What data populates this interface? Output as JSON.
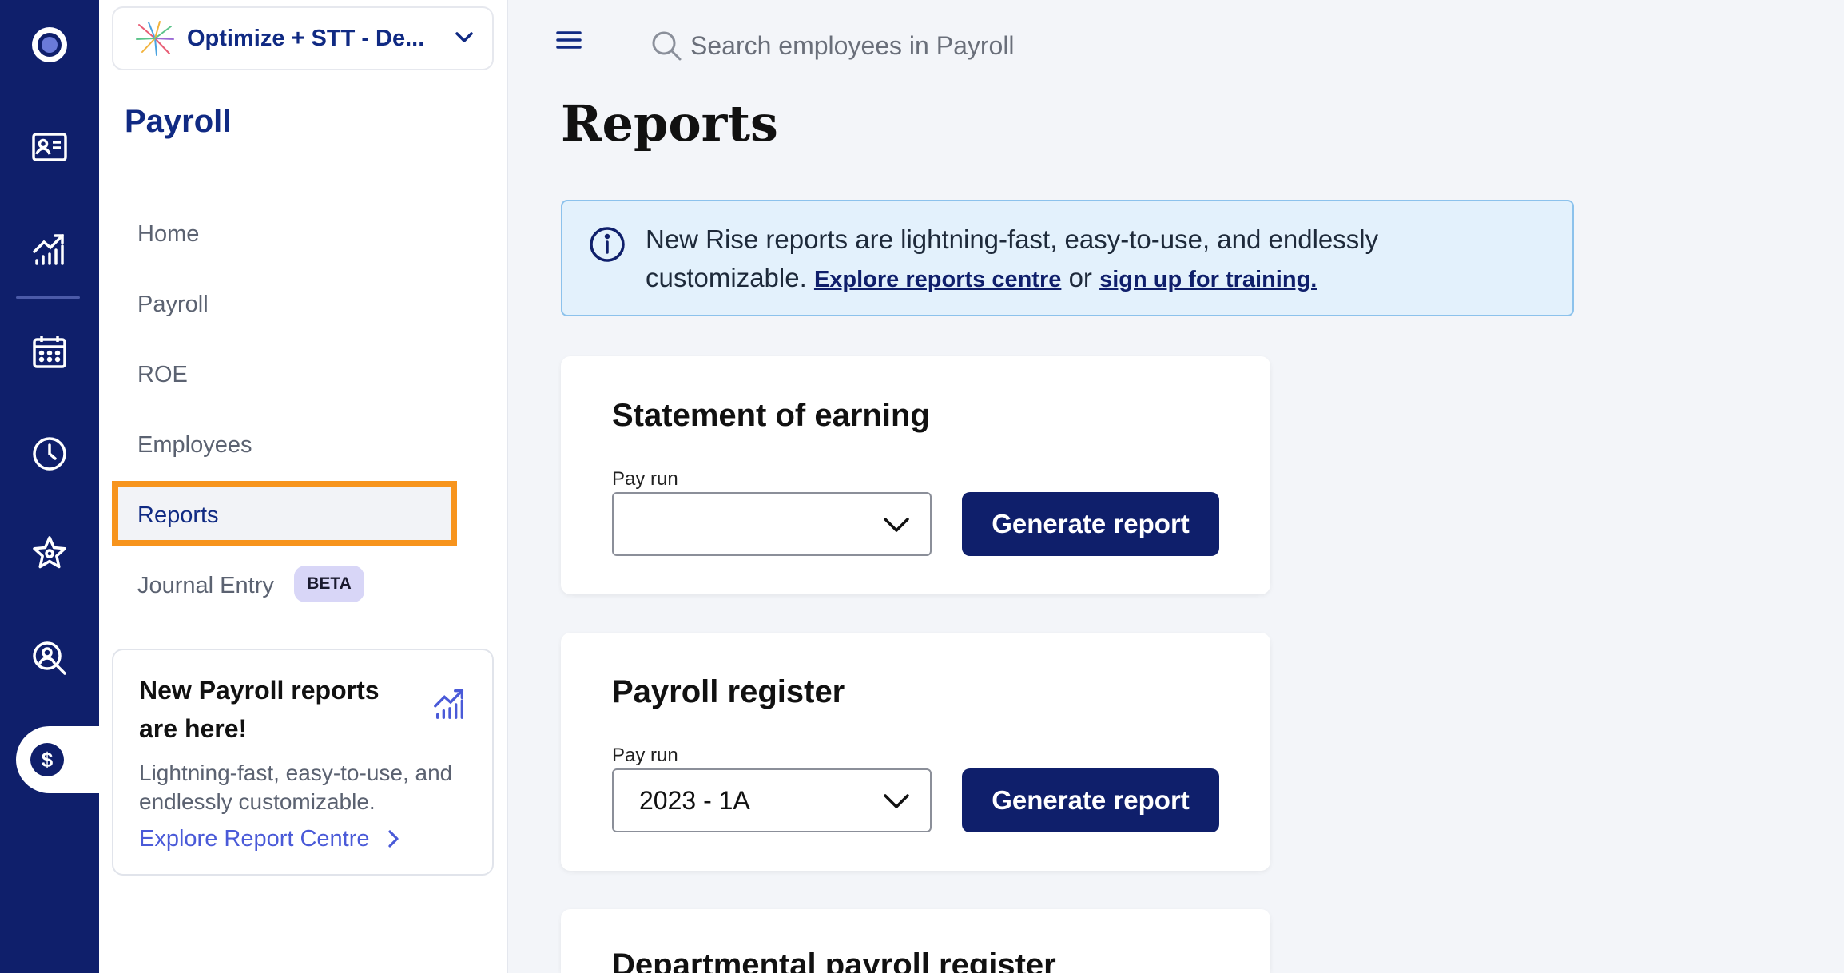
{
  "rail": {
    "items": [
      {
        "icon": "app-logo-icon"
      },
      {
        "icon": "id-card-icon"
      },
      {
        "icon": "analytics-icon"
      },
      {
        "icon": "calendar-icon"
      },
      {
        "icon": "clock-icon"
      },
      {
        "icon": "star-icon"
      },
      {
        "icon": "person-search-icon"
      },
      {
        "icon": "dollar-icon",
        "label": "$"
      }
    ]
  },
  "sidebar": {
    "org_name": "Optimize + STT - De...",
    "section_title": "Payroll",
    "nav": [
      {
        "label": "Home"
      },
      {
        "label": "Payroll"
      },
      {
        "label": "ROE"
      },
      {
        "label": "Employees"
      },
      {
        "label": "Reports",
        "active": true
      },
      {
        "label": "Journal Entry",
        "badge": "BETA"
      }
    ],
    "promo": {
      "title": "New Payroll reports are here!",
      "text": "Lightning-fast, easy-to-use, and endlessly customizable.",
      "link": "Explore Report Centre"
    }
  },
  "header": {
    "search_placeholder": "Search employees in Payroll"
  },
  "main": {
    "title": "Reports",
    "banner": {
      "text_before": "New Rise reports are lightning-fast, easy-to-use, and endlessly customizable.",
      "link1": "Explore reports centre",
      "connector": "or",
      "link2": "sign up for training."
    },
    "cards": [
      {
        "title": "Statement of earning",
        "field_label": "Pay run",
        "field_value": "",
        "button": "Generate report"
      },
      {
        "title": "Payroll register",
        "field_label": "Pay run",
        "field_value": "2023 - 1A",
        "button": "Generate report"
      },
      {
        "title": "Departmental payroll register"
      }
    ]
  },
  "colors": {
    "rail_bg": "#0f1f6b",
    "accent_navy": "#102a83",
    "highlight_orange": "#f7941d",
    "banner_bg": "#e3f1fc",
    "link_purple": "#4a5ad8"
  }
}
